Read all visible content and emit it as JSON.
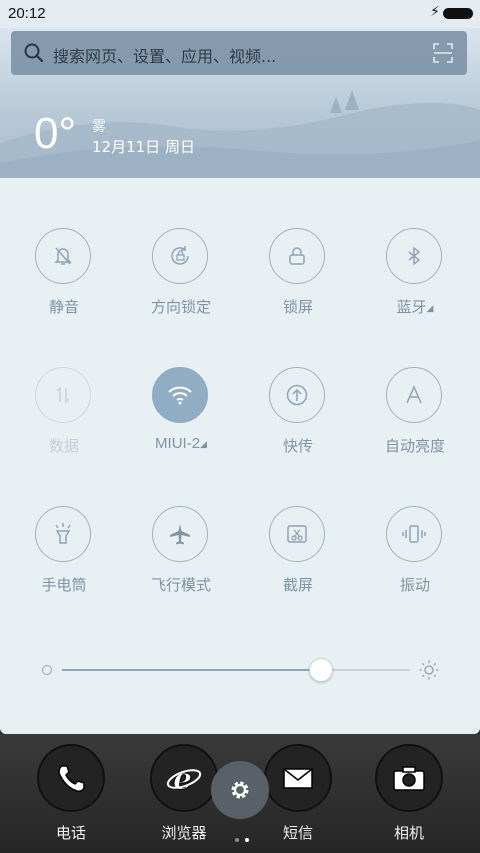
{
  "status_bar": {
    "time": "20:12"
  },
  "search": {
    "placeholder": "搜索网页、设置、应用、视频..."
  },
  "weather": {
    "temperature": "0°",
    "condition": "雾",
    "date": "12月11日 周日"
  },
  "toggles": [
    {
      "label": "静音",
      "icon": "silent-bell-icon",
      "state": "off"
    },
    {
      "label": "方向锁定",
      "icon": "rotation-lock-icon",
      "state": "off"
    },
    {
      "label": "锁屏",
      "icon": "lock-icon",
      "state": "off"
    },
    {
      "label": "蓝牙",
      "icon": "bluetooth-icon",
      "state": "off",
      "has_more": true
    },
    {
      "label": "数据",
      "icon": "mobile-data-icon",
      "state": "disabled"
    },
    {
      "label": "MIUI-2",
      "icon": "wifi-icon",
      "state": "on",
      "has_more": true
    },
    {
      "label": "快传",
      "icon": "quick-transfer-icon",
      "state": "off"
    },
    {
      "label": "自动亮度",
      "icon": "auto-brightness-icon",
      "state": "off"
    },
    {
      "label": "手电筒",
      "icon": "flashlight-icon",
      "state": "off"
    },
    {
      "label": "飞行模式",
      "icon": "airplane-icon",
      "state": "off"
    },
    {
      "label": "截屏",
      "icon": "screenshot-icon",
      "state": "off"
    },
    {
      "label": "振动",
      "icon": "vibrate-icon",
      "state": "off"
    }
  ],
  "brightness": {
    "level": 0.74
  },
  "dock": {
    "apps": [
      {
        "name": "电话",
        "icon": "phone-icon"
      },
      {
        "name": "浏览器",
        "icon": "browser-icon"
      },
      {
        "name": "短信",
        "icon": "message-icon"
      },
      {
        "name": "相机",
        "icon": "camera-icon"
      }
    ],
    "page_count": 2,
    "current_page": 2
  },
  "colors": {
    "accent": "#90adc4",
    "panel_bg": "#e9f0f4",
    "toggle_outline": "#9eb2c2",
    "label_text": "#7d93a6"
  }
}
